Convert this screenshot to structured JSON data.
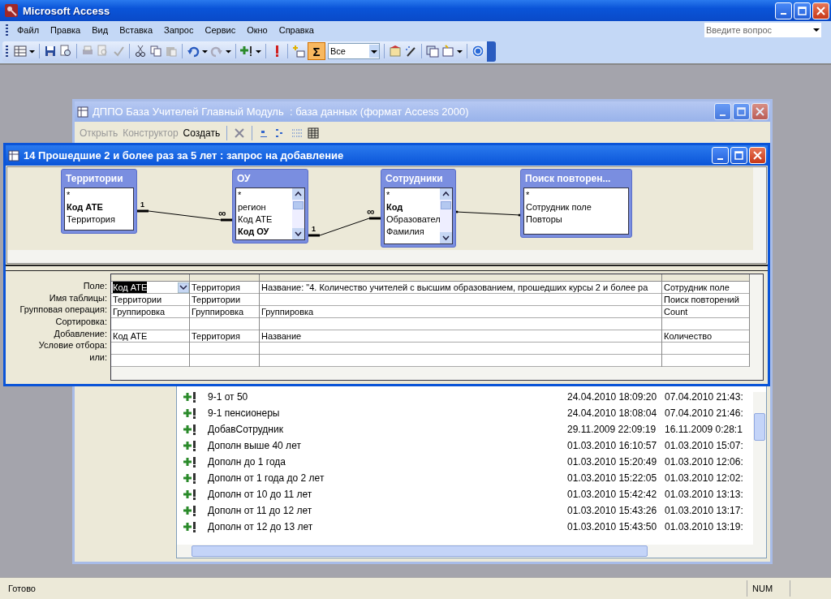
{
  "app": {
    "title": "Microsoft Access",
    "menu": [
      {
        "label": "Файл"
      },
      {
        "label": "Правка"
      },
      {
        "label": "Вид"
      },
      {
        "label": "Вставка"
      },
      {
        "label": "Запрос"
      },
      {
        "label": "Сервис"
      },
      {
        "label": "Окно"
      },
      {
        "label": "Справка"
      }
    ],
    "help_box": {
      "placeholder": "Введите вопрос"
    },
    "toolbar": {
      "combo_value": "Все",
      "totals_button": {
        "label": "Σ",
        "on": true
      }
    },
    "status_bar": {
      "message": "Готово",
      "indicator": "NUM"
    }
  },
  "db_window": {
    "title": "ДППО База Учителей Главный Модуль  : база данных (формат Access 2000)",
    "toolbar": [
      {
        "label": "Открыть",
        "disabled": true
      },
      {
        "label": "Конструктор",
        "disabled": true
      },
      {
        "label": "Создать",
        "disabled": false
      }
    ],
    "queries": [
      {
        "name": "9-1 от 50",
        "created": "24.04.2010 18:09:20",
        "modified": "07.04.2010 21:43:"
      },
      {
        "name": "9-1 пенсионеры",
        "created": "24.04.2010 18:08:04",
        "modified": "07.04.2010 21:46:"
      },
      {
        "name": "ДобавСотрудник",
        "created": "29.11.2009 22:09:19",
        "modified": "16.11.2009 0:28:1"
      },
      {
        "name": "Дополн выше 40 лет",
        "created": "01.03.2010 16:10:57",
        "modified": "01.03.2010 15:07:"
      },
      {
        "name": "Дополн до 1 года",
        "created": "01.03.2010 15:20:49",
        "modified": "01.03.2010 12:06:"
      },
      {
        "name": "Дополн от 1 года до 2 лет",
        "created": "01.03.2010 15:22:05",
        "modified": "01.03.2010 12:02:"
      },
      {
        "name": "Дополн от 10 до 11 лет",
        "created": "01.03.2010 15:42:42",
        "modified": "01.03.2010 13:13:"
      },
      {
        "name": "Дополн от 11 до 12 лет",
        "created": "01.03.2010 15:43:26",
        "modified": "01.03.2010 13:17:"
      },
      {
        "name": "Дополн от 12 до 13 лет",
        "created": "01.03.2010 15:43:50",
        "modified": "01.03.2010 13:19:"
      }
    ]
  },
  "query_window": {
    "title": "14 Прошедшие 2 и более раз за 5 лет : запрос на добавление",
    "tables": [
      {
        "title": "Территории",
        "scrollbar": false,
        "fields": [
          {
            "text": "*",
            "key": false
          },
          {
            "text": "Код АТЕ",
            "key": true
          },
          {
            "text": "Территория",
            "key": false
          }
        ]
      },
      {
        "title": "ОУ",
        "scrollbar": true,
        "fields": [
          {
            "text": "*",
            "key": false
          },
          {
            "text": "регион",
            "key": false
          },
          {
            "text": "Код АТЕ",
            "key": false
          },
          {
            "text": "Код ОУ",
            "key": true
          }
        ]
      },
      {
        "title": "Сотрудники",
        "scrollbar": true,
        "fields": [
          {
            "text": "*",
            "key": false
          },
          {
            "text": "Код",
            "key": true
          },
          {
            "text": "Образовател",
            "key": false
          },
          {
            "text": "Фамилия",
            "key": false
          }
        ]
      },
      {
        "title": "Поиск повторен...",
        "scrollbar": false,
        "fields": [
          {
            "text": "*",
            "key": false
          },
          {
            "text": "Сотрудник поле",
            "key": false
          },
          {
            "text": "Повторы",
            "key": false
          }
        ]
      }
    ],
    "relations": [
      {
        "kind": "one-to-many",
        "one": "1",
        "many": "∞"
      },
      {
        "kind": "one-to-many",
        "one": "1",
        "many": "∞"
      },
      {
        "kind": "plain"
      }
    ],
    "grid": {
      "row_labels": [
        "Поле:",
        "Имя таблицы:",
        "Групповая операция:",
        "Сортировка:",
        "Добавление:",
        "Условие отбора:",
        "или:"
      ],
      "columns": [
        {
          "field_selected": true,
          "cells": [
            "Код АТЕ",
            "Территории",
            "Группировка",
            "",
            "Код АТЕ",
            "",
            ""
          ]
        },
        {
          "field_selected": false,
          "cells": [
            "Территория",
            "Территории",
            "Группировка",
            "",
            "Территория",
            "",
            ""
          ]
        },
        {
          "field_selected": false,
          "cells": [
            "Название: \"4. Количество учителей с высшим образованием, прошедших  курсы 2 и более ра",
            "",
            "Группировка",
            "",
            "Название",
            "",
            ""
          ]
        },
        {
          "field_selected": false,
          "cells": [
            "Сотрудник поле",
            "Поиск повторений",
            "Count",
            "",
            "Количество",
            "",
            ""
          ]
        }
      ]
    }
  }
}
